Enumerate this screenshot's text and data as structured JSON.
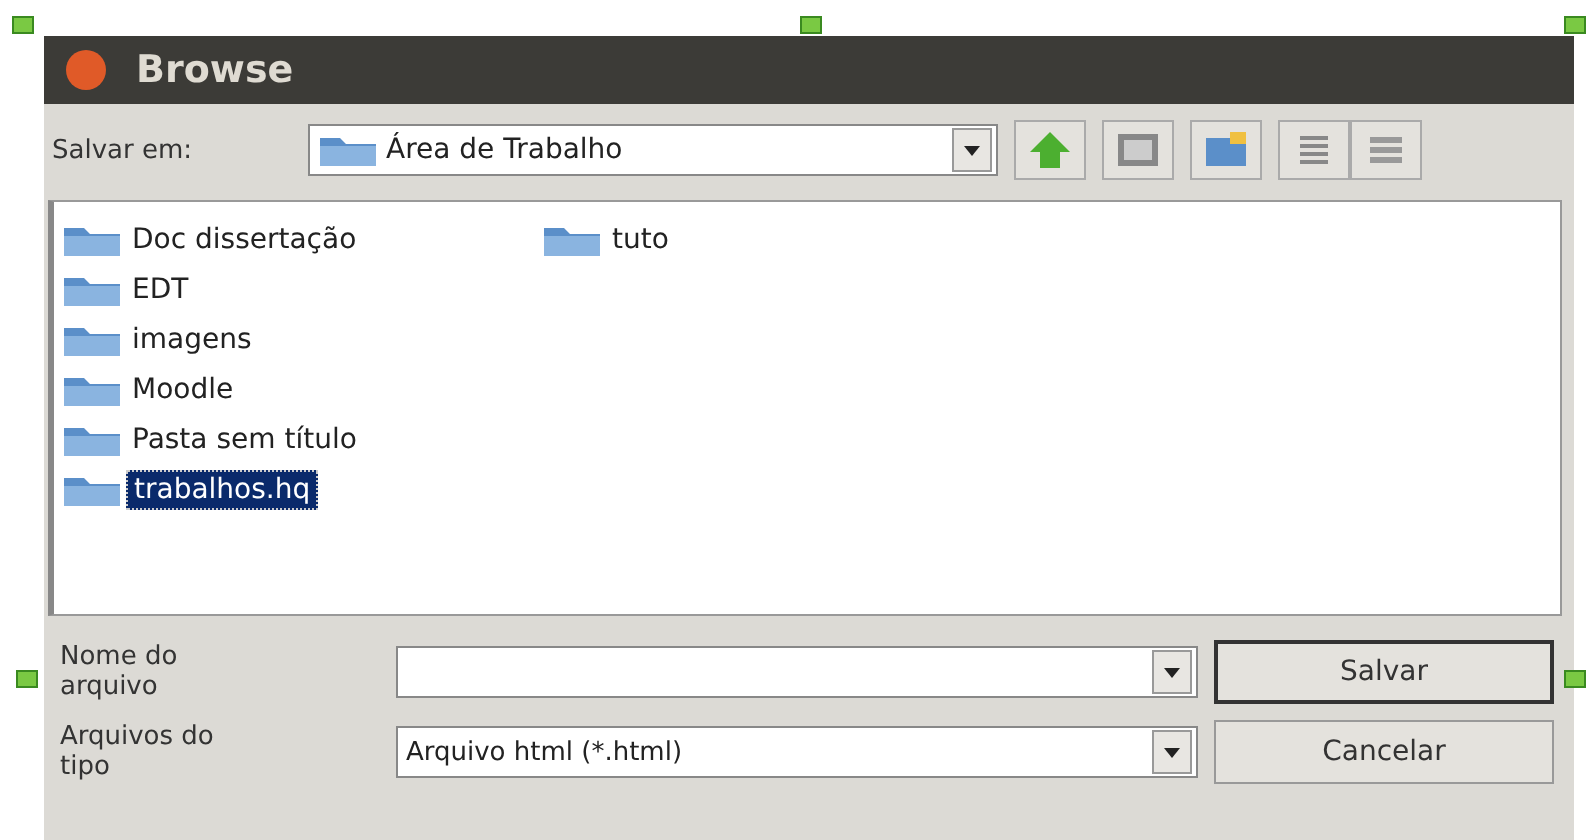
{
  "window": {
    "title": "Browse"
  },
  "location": {
    "label": "Salvar em:",
    "value": "Área de Trabalho"
  },
  "files": [
    {
      "name": "Doc dissertação",
      "selected": false
    },
    {
      "name": "EDT",
      "selected": false
    },
    {
      "name": "imagens",
      "selected": false
    },
    {
      "name": "Moodle",
      "selected": false
    },
    {
      "name": "Pasta sem título",
      "selected": false
    },
    {
      "name": "trabalhos.hq",
      "selected": true
    },
    {
      "name": "tuto",
      "selected": false
    }
  ],
  "file_name": {
    "label": "Nome do arquivo"
  },
  "file_type": {
    "label": "Arquivos do tipo",
    "value": "Arquivo html (*.html)"
  },
  "buttons": [
    {
      "label": "Salvar",
      "default": true
    },
    {
      "label": "Cancelar",
      "default": false
    }
  ]
}
